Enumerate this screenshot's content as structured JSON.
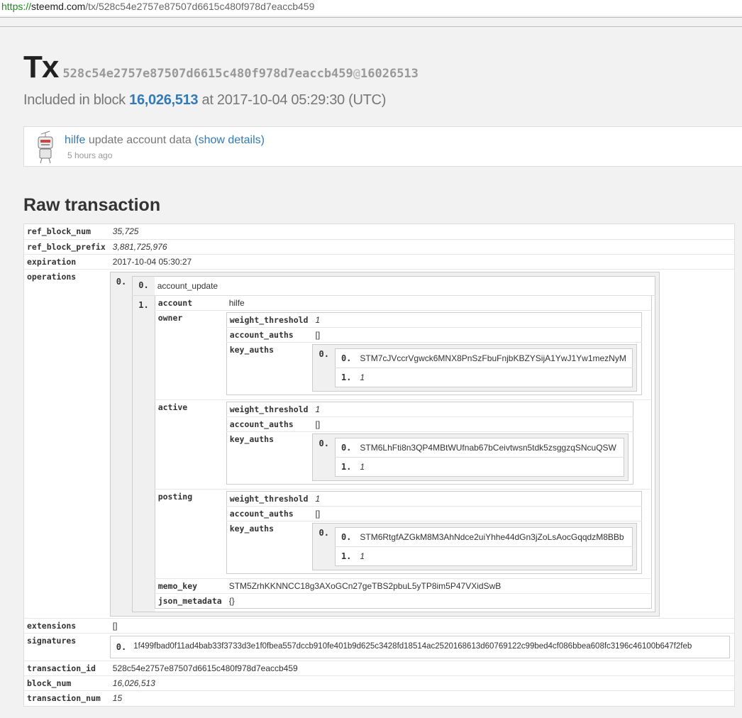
{
  "browser": {
    "url_scheme": "https://",
    "url_host": "steemd.com",
    "url_path": "/tx/528c54e2757e87507d6615c480f978d7eaccb459"
  },
  "header": {
    "tx_label": "Tx",
    "tx_hash": "528c54e2757e87507d6615c480f978d7eaccb459",
    "at_sign": "@",
    "block_ref": "16026513",
    "included_prefix": "Included in block",
    "block_number": "16,026,513",
    "included_suffix": "at 2017-10-04 05:29:30 (UTC)"
  },
  "operation_card": {
    "user": "hilfe",
    "action": "update account data",
    "details_open": "(",
    "details_link": "show details",
    "details_close": ")",
    "time_ago": "5 hours ago",
    "avatar_icon": "robot-avatar-icon"
  },
  "raw": {
    "heading": "Raw transaction",
    "ref_block_num_key": "ref_block_num",
    "ref_block_num": "35,725",
    "ref_block_prefix_key": "ref_block_prefix",
    "ref_block_prefix": "3,881,725,976",
    "expiration_key": "expiration",
    "expiration": "2017-10-04 05:30:27",
    "operations_key": "operations",
    "op_index": "0.",
    "op_type_index": "0.",
    "op_type": "account_update",
    "op_body_index": "1.",
    "account_key": "account",
    "account": "hilfe",
    "owner_key": "owner",
    "active_key": "active",
    "posting_key": "posting",
    "weight_threshold_key": "weight_threshold",
    "account_auths_key": "account_auths",
    "key_auths_key": "key_auths",
    "owner": {
      "weight_threshold": "1",
      "account_auths": "[]",
      "key_idx": "0.",
      "key0_idx": "0.",
      "key": "STM7cJVccrVgwck6MNX8PnSzFbuFnjbKBZYSijA1YwJ1Yw1mezNyM",
      "key1_idx": "1.",
      "weight": "1"
    },
    "active": {
      "weight_threshold": "1",
      "account_auths": "[]",
      "key_idx": "0.",
      "key0_idx": "0.",
      "key": "STM6LhFti8n3QP4MBtWUfnab67bCeivtwsn5tdk5zsggzqSNcuQSW",
      "key1_idx": "1.",
      "weight": "1"
    },
    "posting": {
      "weight_threshold": "1",
      "account_auths": "[]",
      "key_idx": "0.",
      "key0_idx": "0.",
      "key": "STM6RtgfAZGkM8M3AhNdce2uiYhhe44dGn3jZoLsAocGqqdzM8BBb",
      "key1_idx": "1.",
      "weight": "1"
    },
    "memo_key_key": "memo_key",
    "memo_key": "STM5ZrhKKNNCC18g3AXoGCn27geTBS2pbuL5yTP8im5P47VXidSwB",
    "json_metadata_key": "json_metadata",
    "json_metadata": "{}",
    "extensions_key": "extensions",
    "extensions": "[]",
    "signatures_key": "signatures",
    "sig_index": "0.",
    "signature": "1f499fbad0f11ad4bab33f3733d3e1f0fbea557dccb910fe401b9d625c3428fd18514ac2520168613d60769122c99bed4cf086bbea608fc3196c46100b647f2feb",
    "transaction_id_key": "transaction_id",
    "transaction_id": "528c54e2757e87507d6615c480f978d7eaccb459",
    "block_num_key": "block_num",
    "block_num": "16,026,513",
    "transaction_num_key": "transaction_num",
    "transaction_num": "15"
  }
}
